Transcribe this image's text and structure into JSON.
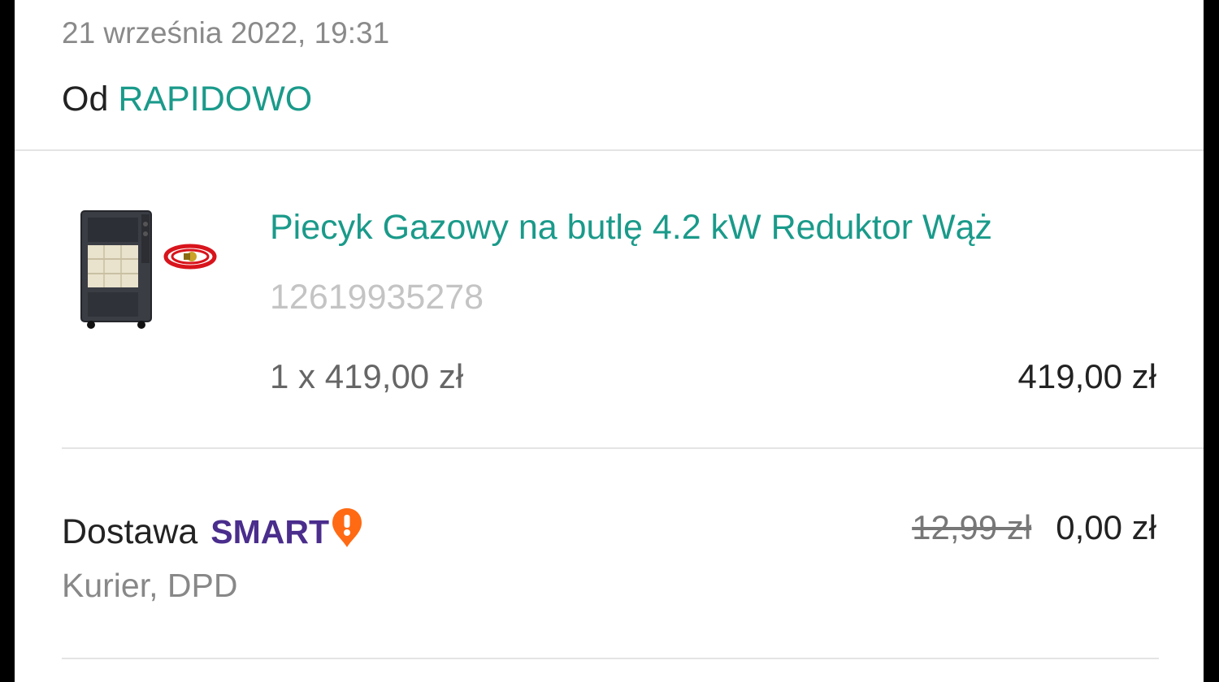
{
  "order": {
    "date": "21 września 2022, 19:31",
    "seller_prefix": "Od",
    "seller_name": "RAPIDOWO"
  },
  "product": {
    "title": "Piecyk Gazowy na butlę 4.2 kW Reduktor Wąż",
    "offer_id": "12619935278",
    "unit_price": "1 x 419,00 zł",
    "total": "419,00 zł",
    "thumbnail_icon": "gas-heater-image"
  },
  "delivery": {
    "label": "Dostawa",
    "badge_text": "SMART",
    "badge_icon": "smart-exclamation-icon",
    "method": "Kurier, DPD",
    "old_price": "12,99 zł",
    "price": "0,00 zł"
  },
  "colors": {
    "accent": "#1a9a8a",
    "smart_purple": "#4a2d8c",
    "smart_orange": "#ff6a13"
  }
}
